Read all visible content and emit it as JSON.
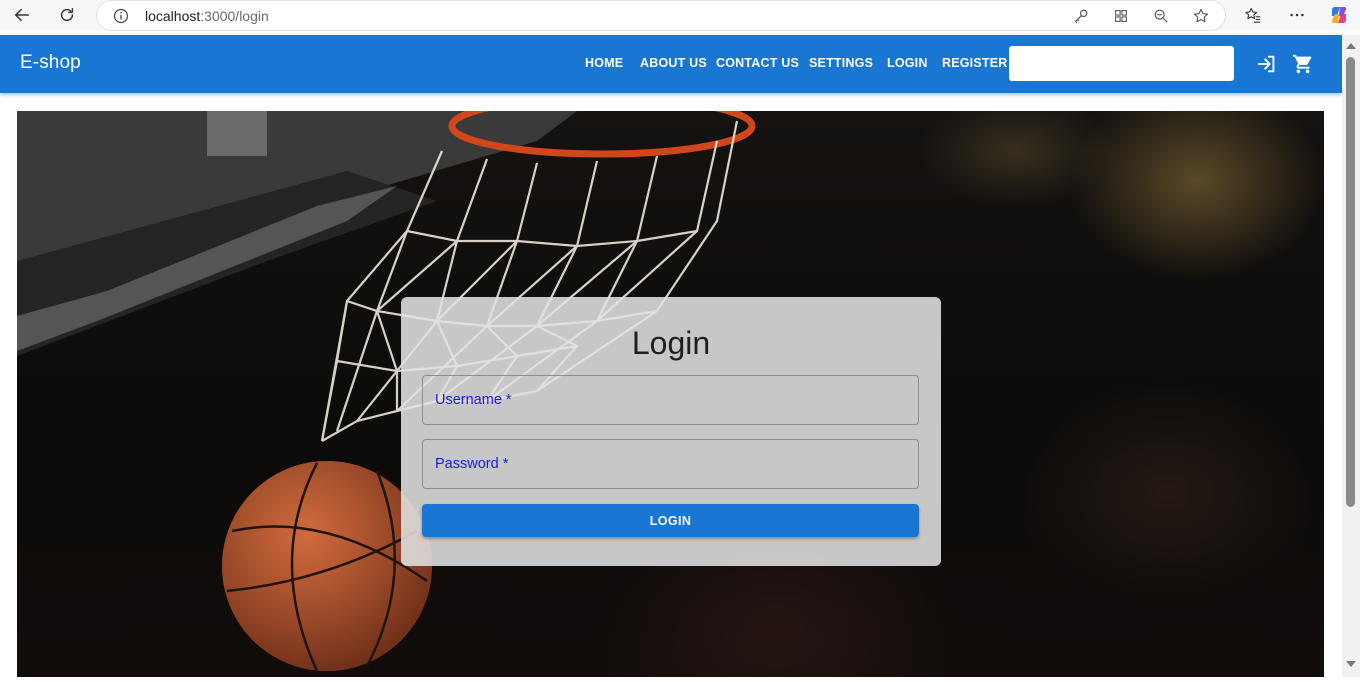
{
  "browser": {
    "url_host": "localhost",
    "url_path": ":3000/login"
  },
  "appbar": {
    "brand": "E-shop",
    "nav": [
      {
        "label": "HOME"
      },
      {
        "label": "ABOUT US"
      },
      {
        "label": "CONTACT US"
      },
      {
        "label": "SETTINGS"
      },
      {
        "label": "LOGIN"
      },
      {
        "label": "REGISTER"
      }
    ],
    "search_value": "",
    "icons": [
      "login-icon",
      "shopping-cart-icon"
    ]
  },
  "login": {
    "title": "Login",
    "username_label": "Username *",
    "password_label": "Password *",
    "submit_label": "LOGIN"
  },
  "colors": {
    "primary": "#1976d2",
    "label": "#1c1cd8"
  }
}
